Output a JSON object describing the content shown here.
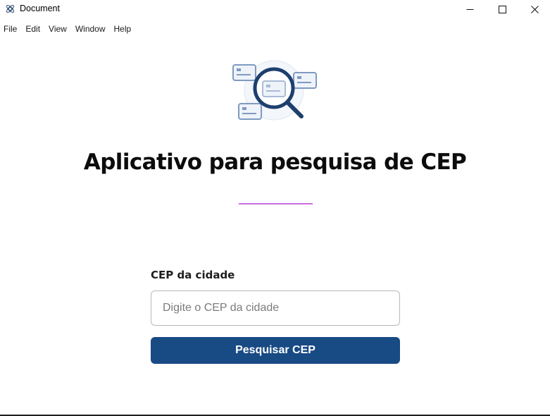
{
  "window": {
    "title": "Document",
    "icons": [
      "app-icon",
      "minimize-icon",
      "maximize-icon",
      "close-icon"
    ]
  },
  "menu": {
    "items": [
      "File",
      "Edit",
      "View",
      "Window",
      "Help"
    ]
  },
  "main": {
    "illustration": "magnifier-search-cards-icon",
    "title": "Aplicativo para pesquisa de CEP",
    "divider_color": "#c96be0"
  },
  "form": {
    "label": "CEP da cidade",
    "placeholder": "Digite o CEP da cidade",
    "value": "",
    "button_label": "Pesquisar CEP",
    "button_color": "#184a84"
  }
}
